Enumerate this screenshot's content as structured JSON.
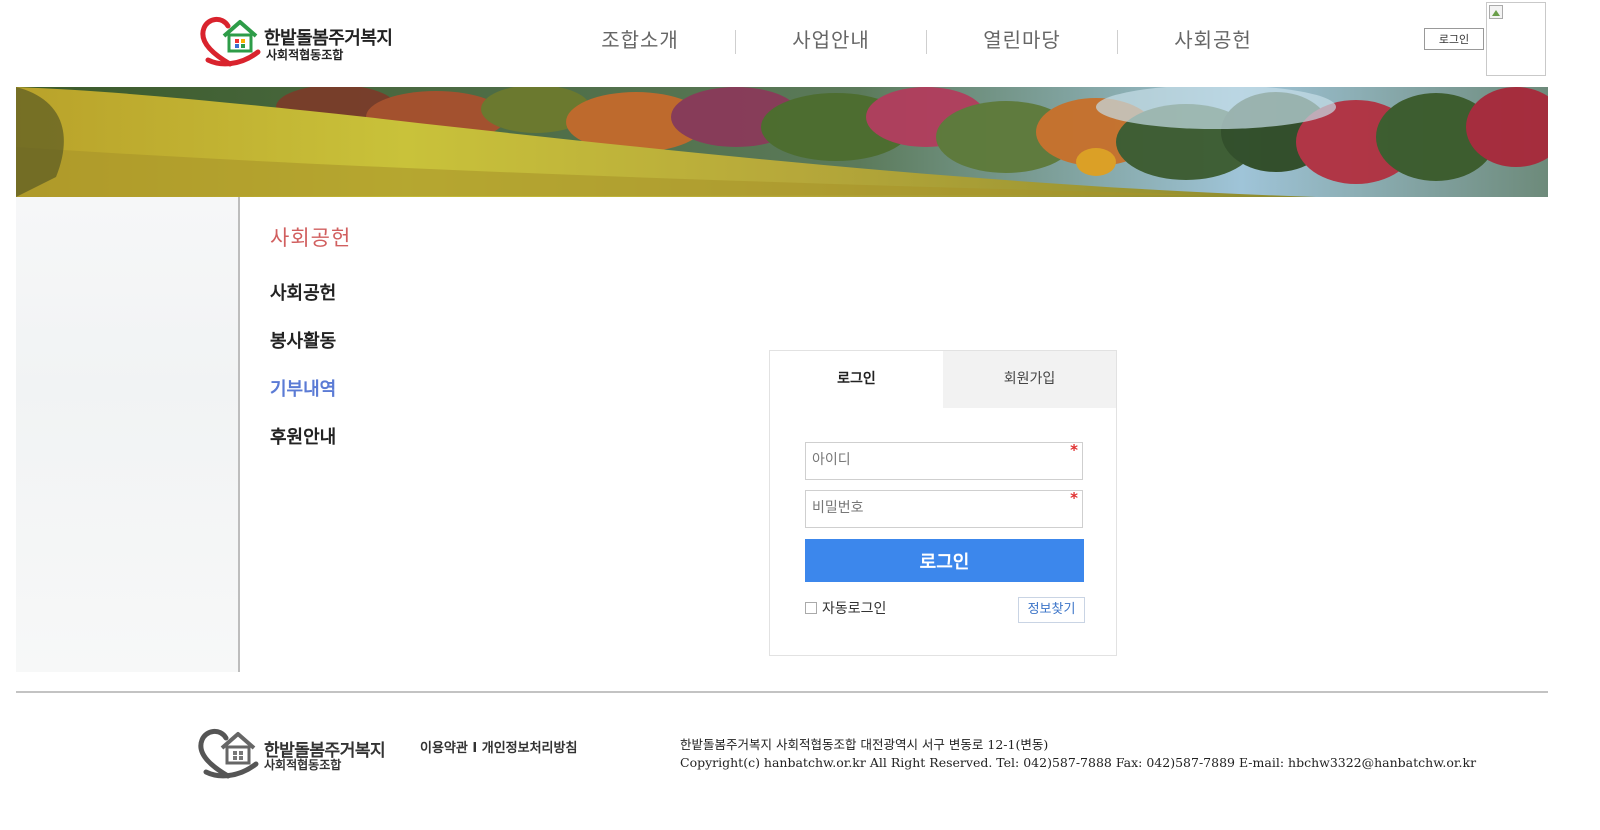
{
  "header": {
    "logo_name": "한밭돌봄주거복지",
    "logo_sub": "사회적협동조합",
    "nav": [
      "조합소개",
      "사업안내",
      "열린마당",
      "사회공헌"
    ],
    "login_button": "로그인"
  },
  "sidebar": {
    "title": "사회공헌",
    "items": [
      {
        "label": "사회공헌",
        "active": false
      },
      {
        "label": "봉사활동",
        "active": false
      },
      {
        "label": "기부내역",
        "active": true
      },
      {
        "label": "후원안내",
        "active": false
      }
    ]
  },
  "login": {
    "tab_login": "로그인",
    "tab_join": "회원가입",
    "id_placeholder": "아이디",
    "pw_placeholder": "비밀번호",
    "required_mark": "*",
    "submit": "로그인",
    "auto_login": "자동로그인",
    "find_info": "정보찾기"
  },
  "footer": {
    "logo_name": "한밭돌봄주거복지",
    "logo_sub": "사회적협동조합",
    "terms": "이용약관",
    "link_sep": "I",
    "privacy": "개인정보처리방침",
    "address": "한밭돌봄주거복지 사회적협동조합 대전광역시 서구 변동로 12-1(변동)",
    "copyright": "Copyright(c) hanbatchw.or.kr All Right Reserved. Tel: 042)587-7888 Fax: 042)587-7889 E-mail: hbchw3322@hanbatchw.or.kr"
  },
  "colors": {
    "accent_blue": "#3c87ec",
    "active_menu": "#5b7bd5",
    "section_title": "#d15f5f",
    "heart_red": "#d9232d",
    "house_green": "#2e9c48"
  }
}
